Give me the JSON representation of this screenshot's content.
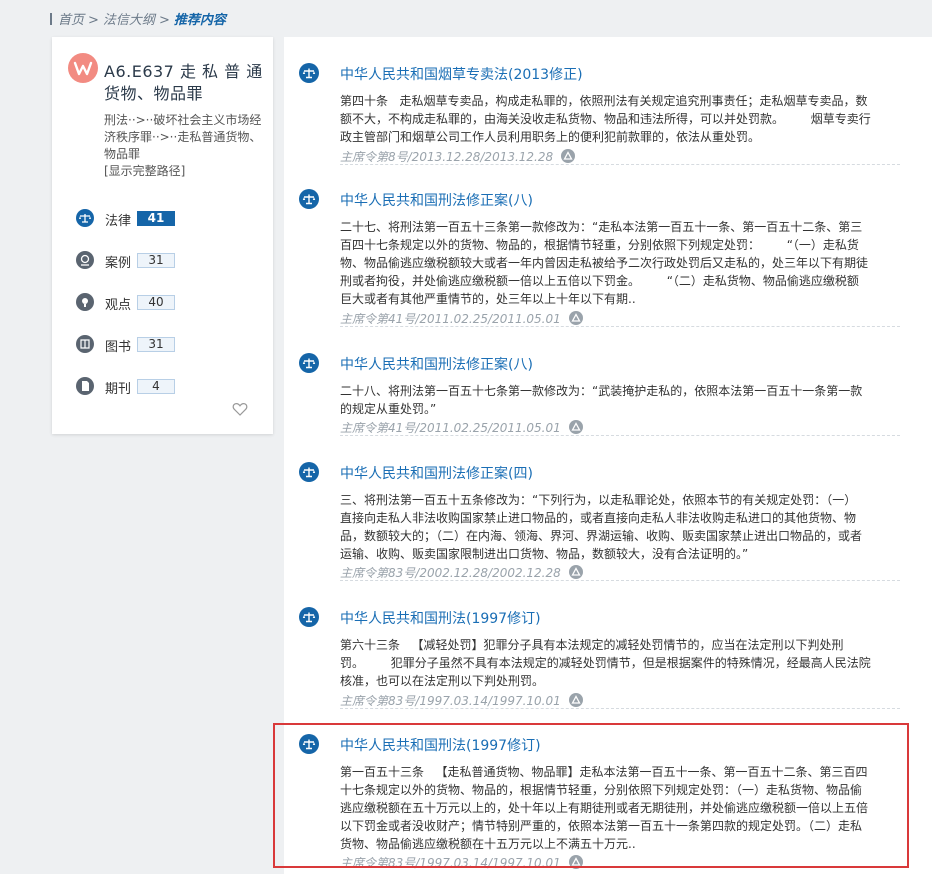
{
  "breadcrumb": {
    "home": "首页",
    "sep1": ">",
    "level2": "法信大纲",
    "sep2": ">",
    "current": "推荐内容"
  },
  "sidebar": {
    "title": "A6.E637 走 私 普 通 货物、物品罪",
    "path": "刑法··>··破坏社会主义市场经济秩序罪··>··走私普通货物、物品罪",
    "full_path_link": "[显示完整路径]",
    "stats": [
      {
        "label": "法律",
        "count": "41",
        "icon": "scales-icon",
        "active": true
      },
      {
        "label": "案例",
        "count": "31",
        "icon": "case-icon",
        "active": false
      },
      {
        "label": "观点",
        "count": "40",
        "icon": "viewpoint-icon",
        "active": false
      },
      {
        "label": "图书",
        "count": "31",
        "icon": "book-icon",
        "active": false
      },
      {
        "label": "期刊",
        "count": "4",
        "icon": "journal-icon",
        "active": false
      }
    ],
    "favorite_icon": "heart-icon"
  },
  "results": [
    {
      "title": "中华人民共和国烟草专卖法(2013修正)",
      "lines": [
        "第四十条   走私烟草专卖品，构成走私罪的，依照刑法有关规定追究刑事责任；走私烟草专卖品，数",
        "额不大，不构成走私罪的，由海关没收走私货物、物品和违法所得，可以并处罚款。       烟草专卖行",
        "政主管部门和烟草公司工作人员利用职务上的便利犯前款罪的，依法从重处罚。"
      ],
      "meta": "主席令第8号/2013.12.28/2013.12.28"
    },
    {
      "title": "中华人民共和国刑法修正案(八)",
      "lines": [
        "二十七、将刑法第一百五十三条第一款修改为：“走私本法第一百五十一条、第一百五十二条、第三",
        "百四十七条规定以外的货物、物品的，根据情节轻重，分别依照下列规定处罚：       “（一）走私货",
        "物、物品偷逃应缴税额较大或者一年内曾因走私被给予二次行政处罚后又走私的，处三年以下有期徒",
        "刑或者拘役，并处偷逃应缴税额一倍以上五倍以下罚金。       “（二）走私货物、物品偷逃应缴税额",
        "巨大或者有其他严重情节的，处三年以上十年以下有期.."
      ],
      "meta": "主席令第41号/2011.02.25/2011.05.01"
    },
    {
      "title": "中华人民共和国刑法修正案(八)",
      "lines": [
        "二十八、将刑法第一百五十七条第一款修改为：“武装掩护走私的，依照本法第一百五十一条第一款",
        "的规定从重处罚。”"
      ],
      "meta": "主席令第41号/2011.02.25/2011.05.01"
    },
    {
      "title": "中华人民共和国刑法修正案(四)",
      "lines": [
        "三、将刑法第一百五十五条修改为：“下列行为，以走私罪论处，依照本节的有关规定处罚：（一）",
        "直接向走私人非法收购国家禁止进口物品的，或者直接向走私人非法收购走私进口的其他货物、物",
        "品，数额较大的；（二）在内海、领海、界河、界湖运输、收购、贩卖国家禁止进出口物品的，或者",
        "运输、收购、贩卖国家限制进出口货物、物品，数额较大，没有合法证明的。”"
      ],
      "meta": "主席令第83号/2002.12.28/2002.12.28"
    },
    {
      "title": "中华人民共和国刑法(1997修订)",
      "lines": [
        "第六十三条   【减轻处罚】犯罪分子具有本法规定的减轻处罚情节的，应当在法定刑以下判处刑",
        "罚。       犯罪分子虽然不具有本法规定的减轻处罚情节，但是根据案件的特殊情况，经最高人民法院",
        "核准，也可以在法定刑以下判处刑罚。"
      ],
      "meta": "主席令第83号/1997.03.14/1997.10.01"
    },
    {
      "title": "中华人民共和国刑法(1997修订)",
      "lines": [
        "第一百五十三条   【走私普通货物、物品罪】走私本法第一百五十一条、第一百五十二条、第三百四",
        "十七条规定以外的货物、物品的，根据情节轻重，分别依照下列规定处罚：（一）走私货物、物品偷",
        "逃应缴税额在五十万元以上的，处十年以上有期徒刑或者无期徒刑，并处偷逃应缴税额一倍以上五倍",
        "以下罚金或者没收财产；情节特别严重的，依照本法第一百五十一条第四款的规定处罚。（二）走私",
        "货物、物品偷逃应缴税额在十五万元以上不满五十万元.."
      ],
      "meta": "主席令第83号/1997.03.14/1997.10.01"
    }
  ],
  "colors": {
    "accent": "#1565a8",
    "title_link": "#1a6eb5",
    "highlight_box": "#d9393a",
    "logo": "#f28b82"
  }
}
